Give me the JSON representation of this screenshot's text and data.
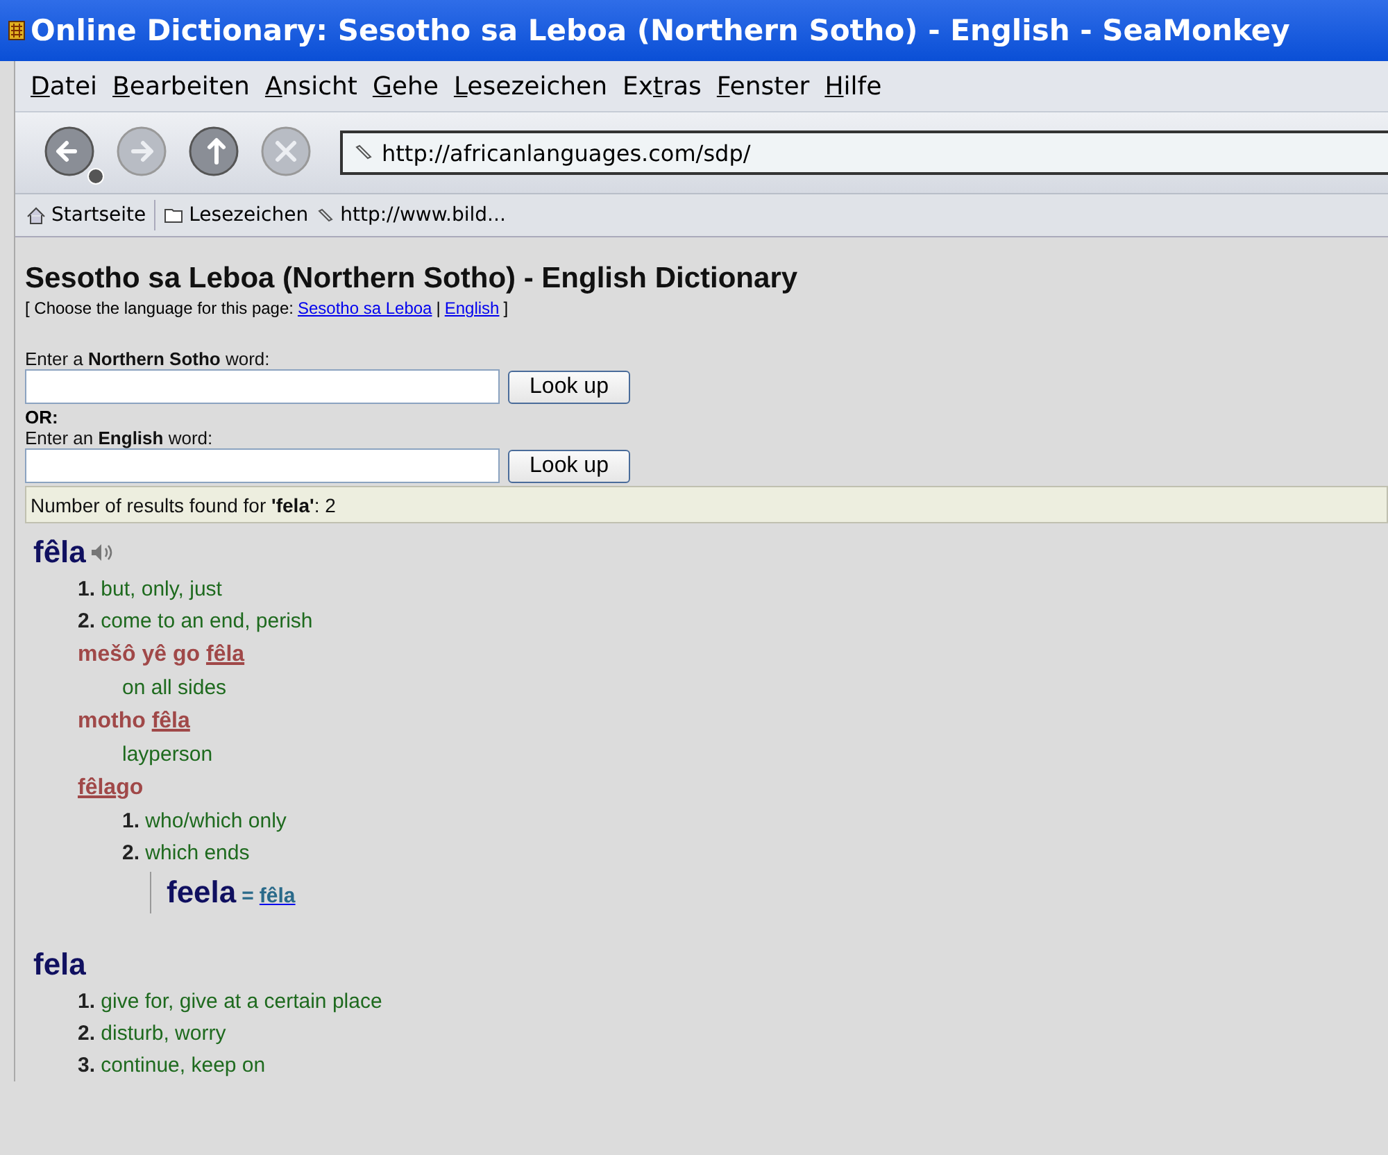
{
  "window": {
    "title": "Online Dictionary: Sesotho sa Leboa (Northern Sotho) - English - SeaMonkey"
  },
  "menu": [
    {
      "key": "D",
      "after": "atei"
    },
    {
      "key": "B",
      "after": "earbeiten"
    },
    {
      "key": "A",
      "after": "nsicht"
    },
    {
      "key": "G",
      "after": "ehe"
    },
    {
      "key": "L",
      "after": "esezeichen"
    },
    {
      "before": "Ex",
      "key": "t",
      "after": "ras"
    },
    {
      "key": "F",
      "after": "enster"
    },
    {
      "key": "H",
      "after": "ilfe"
    }
  ],
  "toolbar": {
    "buttons": [
      {
        "kind": "back",
        "disabled": false
      },
      {
        "kind": "forward",
        "disabled": true
      },
      {
        "kind": "reload",
        "disabled": false
      },
      {
        "kind": "stop",
        "disabled": true
      }
    ],
    "url": "http://africanlanguages.com/sdp/"
  },
  "bookmarks": [
    {
      "kind": "home",
      "label": "Startseite"
    },
    {
      "kind": "folder",
      "label": "Lesezeichen"
    },
    {
      "kind": "link",
      "label": "http://www.bild..."
    }
  ],
  "page": {
    "heading": "Sesotho sa Leboa (Northern Sotho) - English Dictionary",
    "language_prefix": "[ Choose the language for this page:",
    "language_links": [
      "Sesotho sa Leboa",
      "English"
    ],
    "language_separator": "|",
    "language_suffix": "]",
    "forms": [
      {
        "label": "Enter a **Northern Sotho** word:",
        "button": "Look up"
      },
      {
        "label": "Enter an **English** word:",
        "button": "Look up"
      }
    ],
    "or_label": "OR:",
    "results": "Number of results found for **'fela'**: 2",
    "entries": [
      {
        "headword": "fêla",
        "audio": true,
        "items": [
          {
            "kind": "sense",
            "number": "1.",
            "text": "but, only, just"
          },
          {
            "kind": "sense",
            "number": "2.",
            "text": "come to an end, perish"
          },
          {
            "kind": "phrase",
            "parts": [
              {
                "text": "mešô yê go ",
                "underline": false
              },
              {
                "text": "fêla",
                "underline": true
              }
            ],
            "children": [
              {
                "kind": "gloss",
                "text": "on all sides"
              }
            ]
          },
          {
            "kind": "phrase",
            "parts": [
              {
                "text": "motho ",
                "underline": false
              },
              {
                "text": "fêla",
                "underline": true
              }
            ],
            "children": [
              {
                "kind": "gloss",
                "text": "layperson"
              }
            ]
          },
          {
            "kind": "phrase",
            "parts": [
              {
                "text": "fêla",
                "underline": true
              },
              {
                "text": "go",
                "underline": false
              }
            ],
            "children": [
              {
                "kind": "sense",
                "number": "1.",
                "text": "who/which only"
              },
              {
                "kind": "sense",
                "number": "2.",
                "text": "which ends"
              },
              {
                "kind": "xref",
                "headword": "feela",
                "sign": "=",
                "target": "fêla"
              }
            ]
          }
        ]
      },
      {
        "headword": "fela",
        "audio": false,
        "items": [
          {
            "kind": "sense",
            "number": "1.",
            "text": "give for, give at a certain place"
          },
          {
            "kind": "sense",
            "number": "2.",
            "text": "disturb, worry"
          },
          {
            "kind": "sense",
            "number": "3.",
            "text": "continue, keep on"
          }
        ]
      }
    ]
  }
}
